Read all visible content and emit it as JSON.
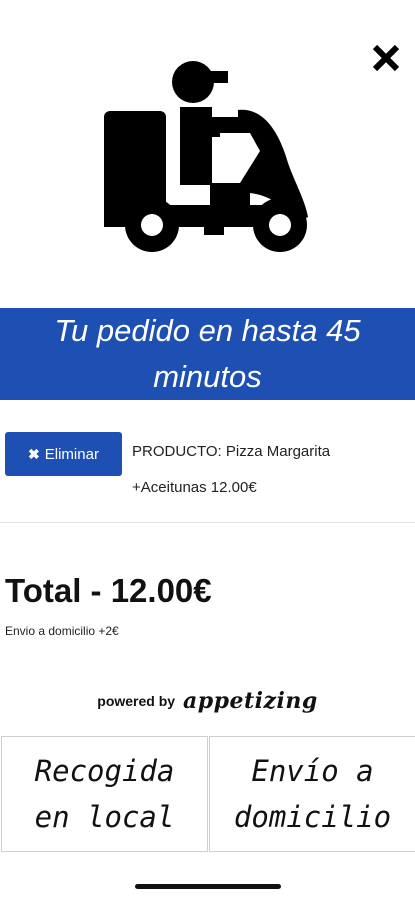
{
  "header": {
    "close_icon": "close-icon",
    "hero_icon": "delivery-scooter-icon"
  },
  "banner": {
    "message": "Tu pedido en hasta 45 minutos",
    "color": "#1e4fb3"
  },
  "cart": {
    "remove_label": "Eliminar",
    "remove_icon": "x-icon",
    "item_line1": "PRODUCTO: Pizza Margarita",
    "item_line2": "+Aceitunas 12.00€"
  },
  "summary": {
    "total": "Total - 12.00€",
    "shipping_note": "Envio a domicilio +2€"
  },
  "branding": {
    "powered_by": "powered by",
    "brand": "appetizing"
  },
  "options": {
    "pickup_label": "Recogida en local",
    "delivery_label": "Envío a domicilio"
  }
}
